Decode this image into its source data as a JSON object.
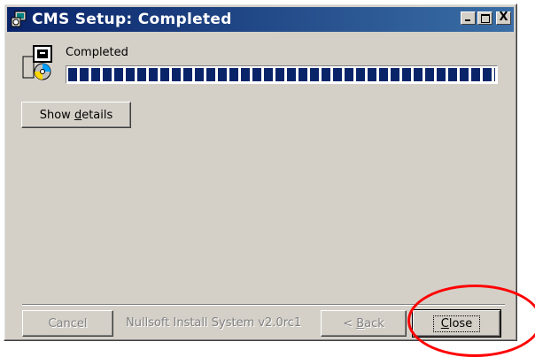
{
  "window": {
    "title": "CMS Setup: Completed",
    "title_icon": "setup-computer-icon",
    "controls": [
      "minimize-icon",
      "maximize-icon",
      "close-icon"
    ],
    "close_glyph": "X"
  },
  "status": {
    "text": "Completed",
    "progress_fraction": 1.0
  },
  "show_details_button": {
    "label_pre": "Show ",
    "label_key": "d",
    "label_post": "etails"
  },
  "footer": {
    "brand_text": "Nullsoft Install System v2.0rc1",
    "cancel_label": "Cancel",
    "back_label_pre": "< ",
    "back_key": "B",
    "back_label_post": "ack",
    "close_key": "C",
    "close_label_post": "lose"
  },
  "annotation": {
    "color": "#ff0000"
  },
  "colors": {
    "titlebar_start": "#0a246a",
    "titlebar_end": "#3a6ea5",
    "face": "#d4d0c8",
    "progress": "#0a246a"
  }
}
